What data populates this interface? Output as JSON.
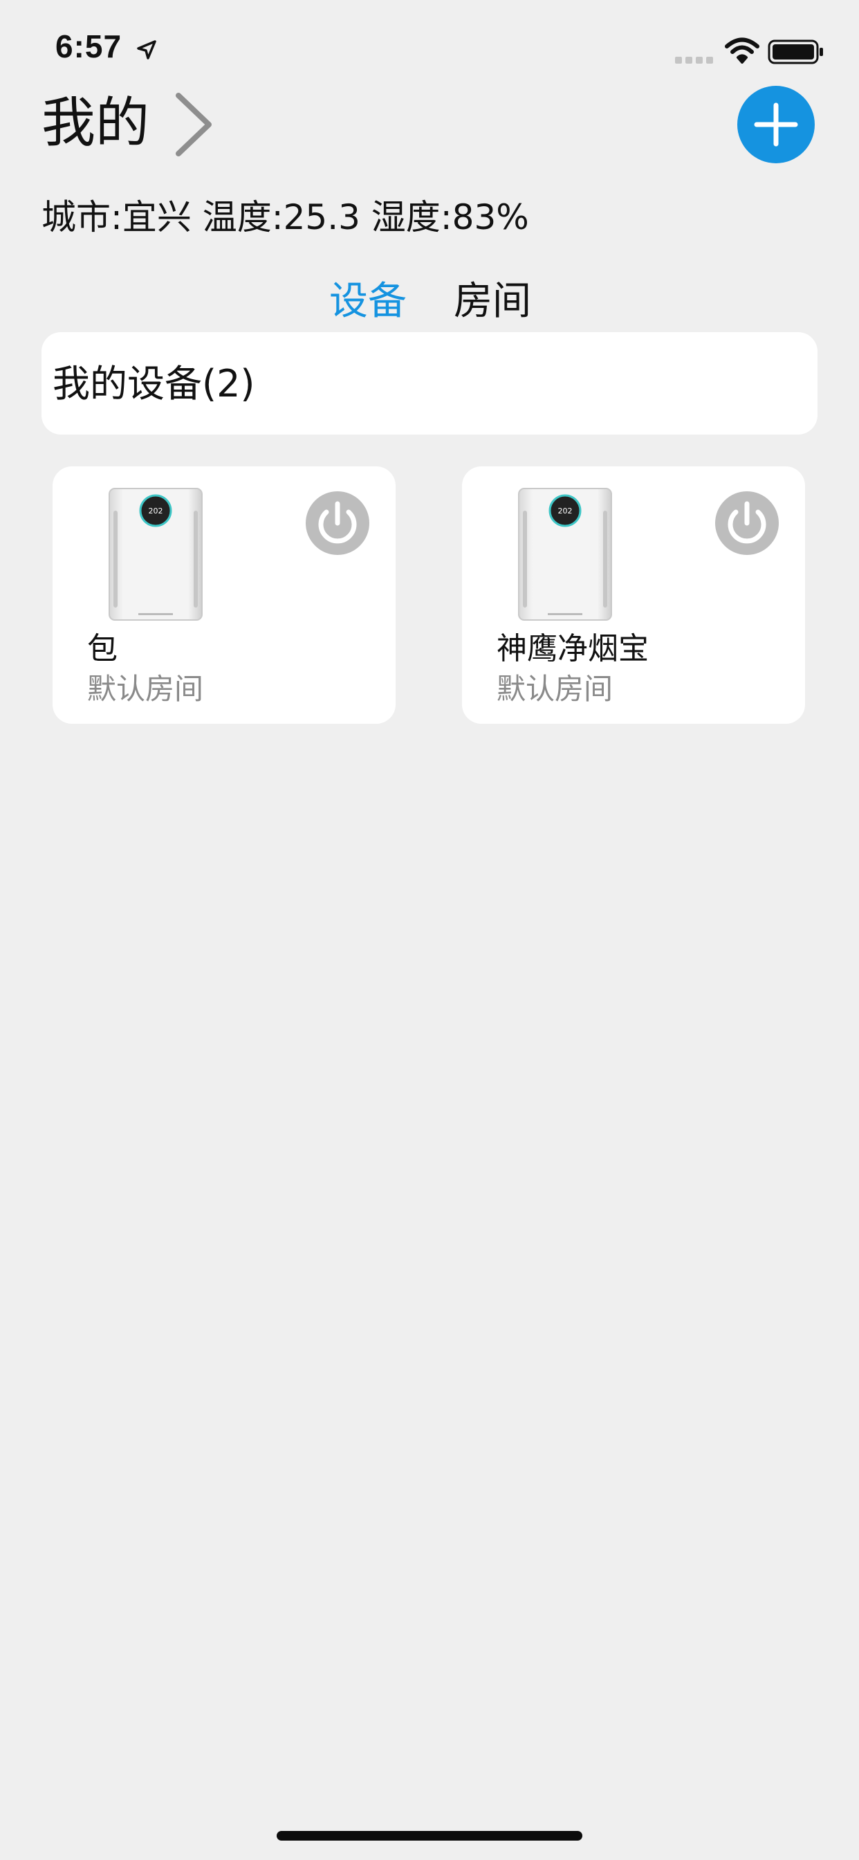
{
  "status_bar": {
    "time": "6:57"
  },
  "header": {
    "title": "我的"
  },
  "weather": {
    "text": "城市:宜兴 温度:25.3 湿度:83%"
  },
  "tabs": [
    {
      "label": "设备",
      "active": true
    },
    {
      "label": "房间",
      "active": false
    }
  ],
  "section": {
    "title": "我的设备(2)"
  },
  "devices": [
    {
      "name": "包",
      "room": "默认房间",
      "power_on": false
    },
    {
      "name": "神鹰净烟宝",
      "room": "默认房间",
      "power_on": false
    }
  ],
  "colors": {
    "accent": "#1593e0",
    "background": "#efefef",
    "card": "#ffffff",
    "power_off": "#bdbdbd",
    "secondary_text": "#8a8a8a"
  },
  "icons": {
    "location": "location-arrow-icon",
    "signal": "cellular-signal-icon",
    "wifi": "wifi-icon",
    "battery": "battery-icon",
    "chevron": "chevron-right-icon",
    "add": "plus-icon",
    "power": "power-icon",
    "device": "air-purifier-image"
  }
}
